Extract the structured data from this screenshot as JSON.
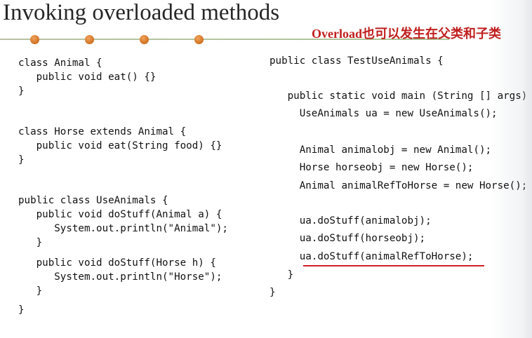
{
  "title": "Invoking overloaded methods",
  "subtitle": "Overload也可以发生在父类和子类",
  "left_code": [
    "class Animal {",
    "   public void eat() {}",
    "}",
    "class Horse extends Animal {",
    "   public void eat(String food) {}",
    "}",
    "public class UseAnimals {",
    "   public void doStuff(Animal a) {",
    "      System.out.println(\"Animal\");",
    "   }",
    "   public void doStuff(Horse h) {",
    "      System.out.println(\"Horse\");",
    "   }",
    "}"
  ],
  "right_code": [
    "public class TestUseAnimals {",
    "   public static void main (String [] args) {",
    "     UseAnimals ua = new UseAnimals();",
    "     Animal animalobj = new Animal();",
    "     Horse horseobj = new Horse();",
    "     Animal animalRefToHorse = new Horse();",
    "     ua.doStuff(animalobj);",
    "     ua.doStuff(horseobj);",
    "     ua.doStuff(animalRefToHorse);",
    "   }",
    "}"
  ],
  "colors": {
    "title": "#262626",
    "subtitle": "#c0201f",
    "dots": "#d77a2c",
    "underline": "#cf1f24"
  }
}
